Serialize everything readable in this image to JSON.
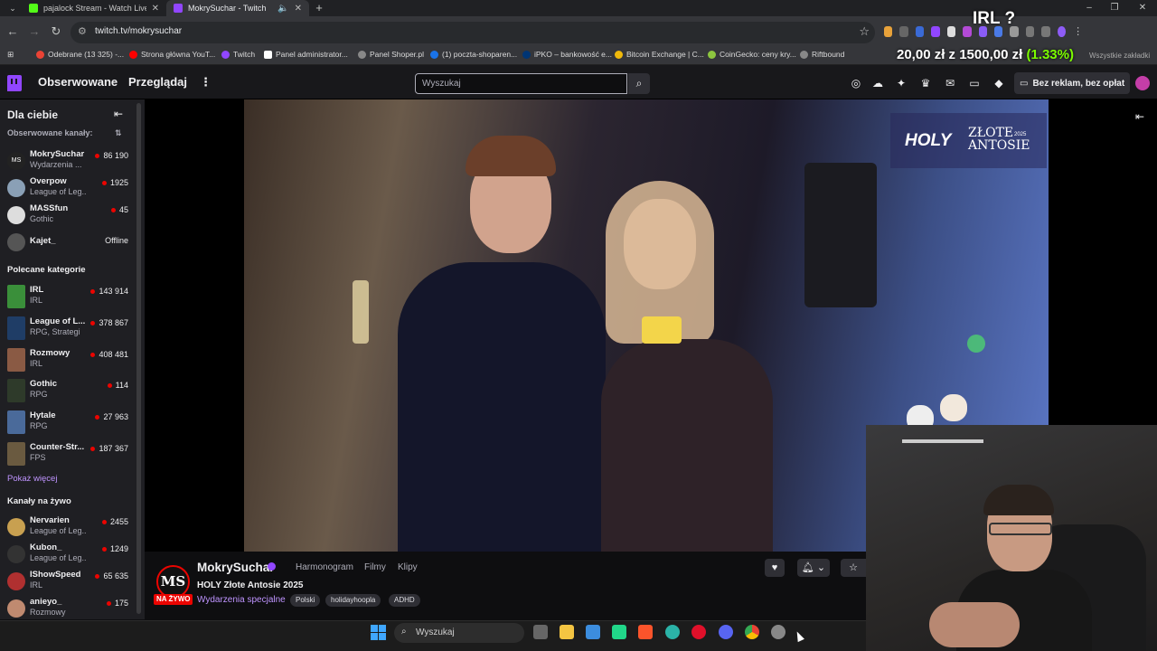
{
  "browser": {
    "tabs": [
      {
        "title": "pajalock Stream - Watch Live on",
        "favicon_color": "#53fc18",
        "active": false
      },
      {
        "title": "MokrySuchar - Twitch",
        "favicon_color": "#9146ff",
        "active": true
      }
    ],
    "new_tab": "+",
    "url": "twitch.tv/mokrysuchar",
    "bookmarks": [
      {
        "label": "Odebrane (13 325) -...",
        "color": "#ea4335"
      },
      {
        "label": "Strona główna YouT...",
        "color": "#ff0000"
      },
      {
        "label": "Twitch",
        "color": "#9146ff"
      },
      {
        "label": "Panel administrator...",
        "color": "#ffffff"
      },
      {
        "label": "Panel Shoper.pl",
        "color": "#888888"
      },
      {
        "label": "(1) poczta-shoparen...",
        "color": "#1a73e8"
      },
      {
        "label": "iPKO – bankowość e...",
        "color": "#003574"
      },
      {
        "label": "Bitcoin Exchange | C...",
        "color": "#f0b90b"
      },
      {
        "label": "CoinGecko: ceny kry...",
        "color": "#8dc63f"
      },
      {
        "label": "Riftbound",
        "color": "#888888"
      }
    ],
    "all_bookmarks": "Wszystkie zakładki"
  },
  "overlay": {
    "irl": "IRL ?",
    "money_prefix": "20,00 zł",
    "money_sep": "z",
    "money_goal": "1500,00 zł",
    "money_pct": "(1.33%)",
    "holy_logo": "HOLY",
    "holy_title_line1": "ZŁOTE",
    "holy_title_line2": "ANTOSIE",
    "holy_year": "2025"
  },
  "nav": {
    "followed": "Obserwowane",
    "browse": "Przeglądaj",
    "more": "⋮",
    "search_placeholder": "Wyszukaj",
    "no_ads": "Bez reklam, bez opłat"
  },
  "sidebar": {
    "title": "Dla ciebie",
    "followed_header": "Obserwowane kanały:",
    "followed": [
      {
        "name": "MokrySuchar",
        "category": "Wydarzenia ...",
        "viewers": "86 190",
        "live": true,
        "color": "#222"
      },
      {
        "name": "Overpow",
        "category": "League of Leg...",
        "viewers": "1925",
        "live": true,
        "color": "#8aa0b6"
      },
      {
        "name": "MASSfun",
        "category": "Gothic",
        "viewers": "45",
        "live": true,
        "color": "#ddd"
      },
      {
        "name": "Kajet_",
        "category": "",
        "viewers": "Offline",
        "live": false,
        "color": "#555"
      }
    ],
    "categories_header": "Polecane kategorie",
    "categories": [
      {
        "name": "IRL",
        "category": "IRL",
        "viewers": "143 914",
        "color": "#3a8f3a"
      },
      {
        "name": "League of L...",
        "category": "RPG, Strategi",
        "viewers": "378 867",
        "color": "#1f3d66"
      },
      {
        "name": "Rozmowy",
        "category": "IRL",
        "viewers": "408 481",
        "color": "#8a5a44"
      },
      {
        "name": "Gothic",
        "category": "RPG",
        "viewers": "114",
        "color": "#2e3a2a"
      },
      {
        "name": "Hytale",
        "category": "RPG",
        "viewers": "27 963",
        "color": "#4a6a9a"
      },
      {
        "name": "Counter-Str...",
        "category": "FPS",
        "viewers": "187 367",
        "color": "#6a5a40"
      }
    ],
    "show_more": "Pokaż więcej",
    "live_header": "Kanały na żywo",
    "live": [
      {
        "name": "Nervarien",
        "category": "League of Leg...",
        "viewers": "2455",
        "color": "#c8a050"
      },
      {
        "name": "Kubon_",
        "category": "League of Leg...",
        "viewers": "1249",
        "color": "#333"
      },
      {
        "name": "IShowSpeed",
        "category": "IRL",
        "viewers": "65 635",
        "color": "#b03030"
      },
      {
        "name": "anieyo_",
        "category": "Rozmowy",
        "viewers": "175",
        "color": "#c08a70"
      }
    ]
  },
  "channel": {
    "avatar_text": "MS",
    "live_badge": "NA ŻYWO",
    "name": "MokrySuchar",
    "tabs": [
      "Harmonogram",
      "Filmy",
      "Klipy"
    ],
    "stream_title": "HOLY Złote Antosie 2025",
    "category": "Wydarzenia specjalne",
    "tags": [
      "Polski",
      "holidayhoopla",
      "ADHD"
    ]
  },
  "taskbar": {
    "search_placeholder": "Wyszukaj",
    "apps": [
      {
        "name": "task-view",
        "color": "#666"
      },
      {
        "name": "file-explorer",
        "color": "#f4c542"
      },
      {
        "name": "ms-store",
        "color": "#3c8dde"
      },
      {
        "name": "pycharm",
        "color": "#21d789"
      },
      {
        "name": "brave",
        "color": "#fb542b"
      },
      {
        "name": "edge",
        "color": "#2bb3a8"
      },
      {
        "name": "opera",
        "color": "#e0102a"
      },
      {
        "name": "discord",
        "color": "#5865f2"
      },
      {
        "name": "chrome",
        "color": "#fbbc05"
      },
      {
        "name": "settings",
        "color": "#888"
      }
    ]
  }
}
